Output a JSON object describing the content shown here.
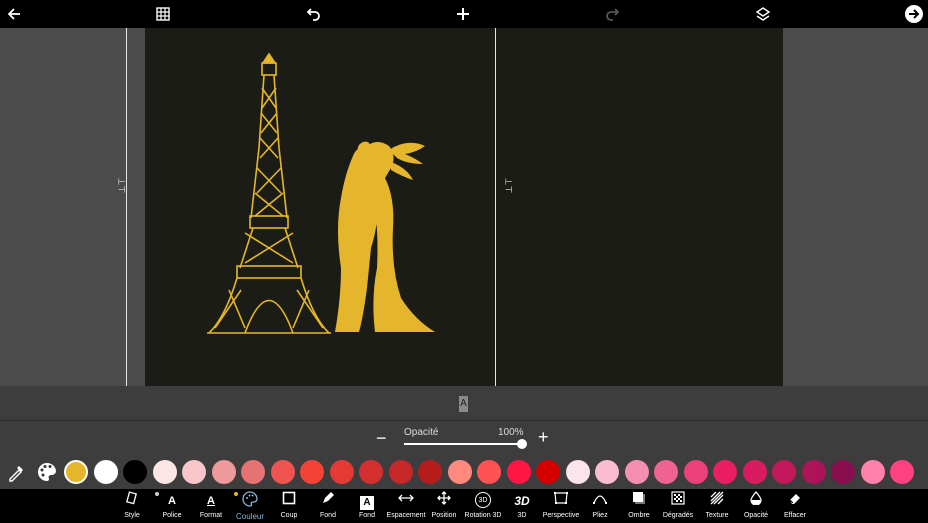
{
  "toolbar": {
    "icons": [
      "back-arrow-icon",
      "grid-icon",
      "undo-icon",
      "add-icon",
      "redo-icon",
      "layers-icon",
      "next-icon"
    ]
  },
  "strip": {
    "letter": "A"
  },
  "opacity": {
    "label": "Opacité",
    "value": "100%",
    "minus": "−",
    "plus": "+",
    "level": 1.0
  },
  "palette": {
    "selected_color": "#e5b62b",
    "colors": [
      "#e5b62b",
      "#ffffff",
      "#000000",
      "#fde4e6",
      "#f9c6c9",
      "#ef9a9a",
      "#e57373",
      "#ef5350",
      "#f44336",
      "#e53935",
      "#d32f2f",
      "#c62828",
      "#b71c1c",
      "#ff8a80",
      "#ff5252",
      "#ff1744",
      "#d50000",
      "#fce4ec",
      "#f8bbd0",
      "#f48fb1",
      "#f06292",
      "#ec407a",
      "#e91e63",
      "#d81b60",
      "#c2185b",
      "#ad1457",
      "#880e4f",
      "#ff80ab",
      "#ff4081"
    ]
  },
  "bottom_tools": [
    {
      "id": "style",
      "label": "Style"
    },
    {
      "id": "police",
      "label": "Police"
    },
    {
      "id": "format",
      "label": "Format"
    },
    {
      "id": "couleur",
      "label": "Couleur"
    },
    {
      "id": "coup",
      "label": "Coup"
    },
    {
      "id": "fond-pen",
      "label": "Fond"
    },
    {
      "id": "fond-a",
      "label": "Fond"
    },
    {
      "id": "espacement",
      "label": "Espacement"
    },
    {
      "id": "position",
      "label": "Position"
    },
    {
      "id": "rotation3d",
      "label": "Rotation 3D"
    },
    {
      "id": "3d",
      "label": "3D"
    },
    {
      "id": "perspective",
      "label": "Perspective"
    },
    {
      "id": "pliez",
      "label": "Pliez"
    },
    {
      "id": "ombre",
      "label": "Ombre"
    },
    {
      "id": "degrades",
      "label": "Dégradés"
    },
    {
      "id": "texture",
      "label": "Texture"
    },
    {
      "id": "opacite",
      "label": "Opacité"
    },
    {
      "id": "effacer",
      "label": "Effacer"
    }
  ],
  "icon_glyphs": {
    "a_letter": "A",
    "three_d_bold": "3D",
    "three_d_small": "3D"
  },
  "colors": {
    "canvas": "#1c1c16",
    "artwork": "#e5b62b",
    "active_tab": "#8ab4d8",
    "workspace": "#4b4b4b"
  }
}
